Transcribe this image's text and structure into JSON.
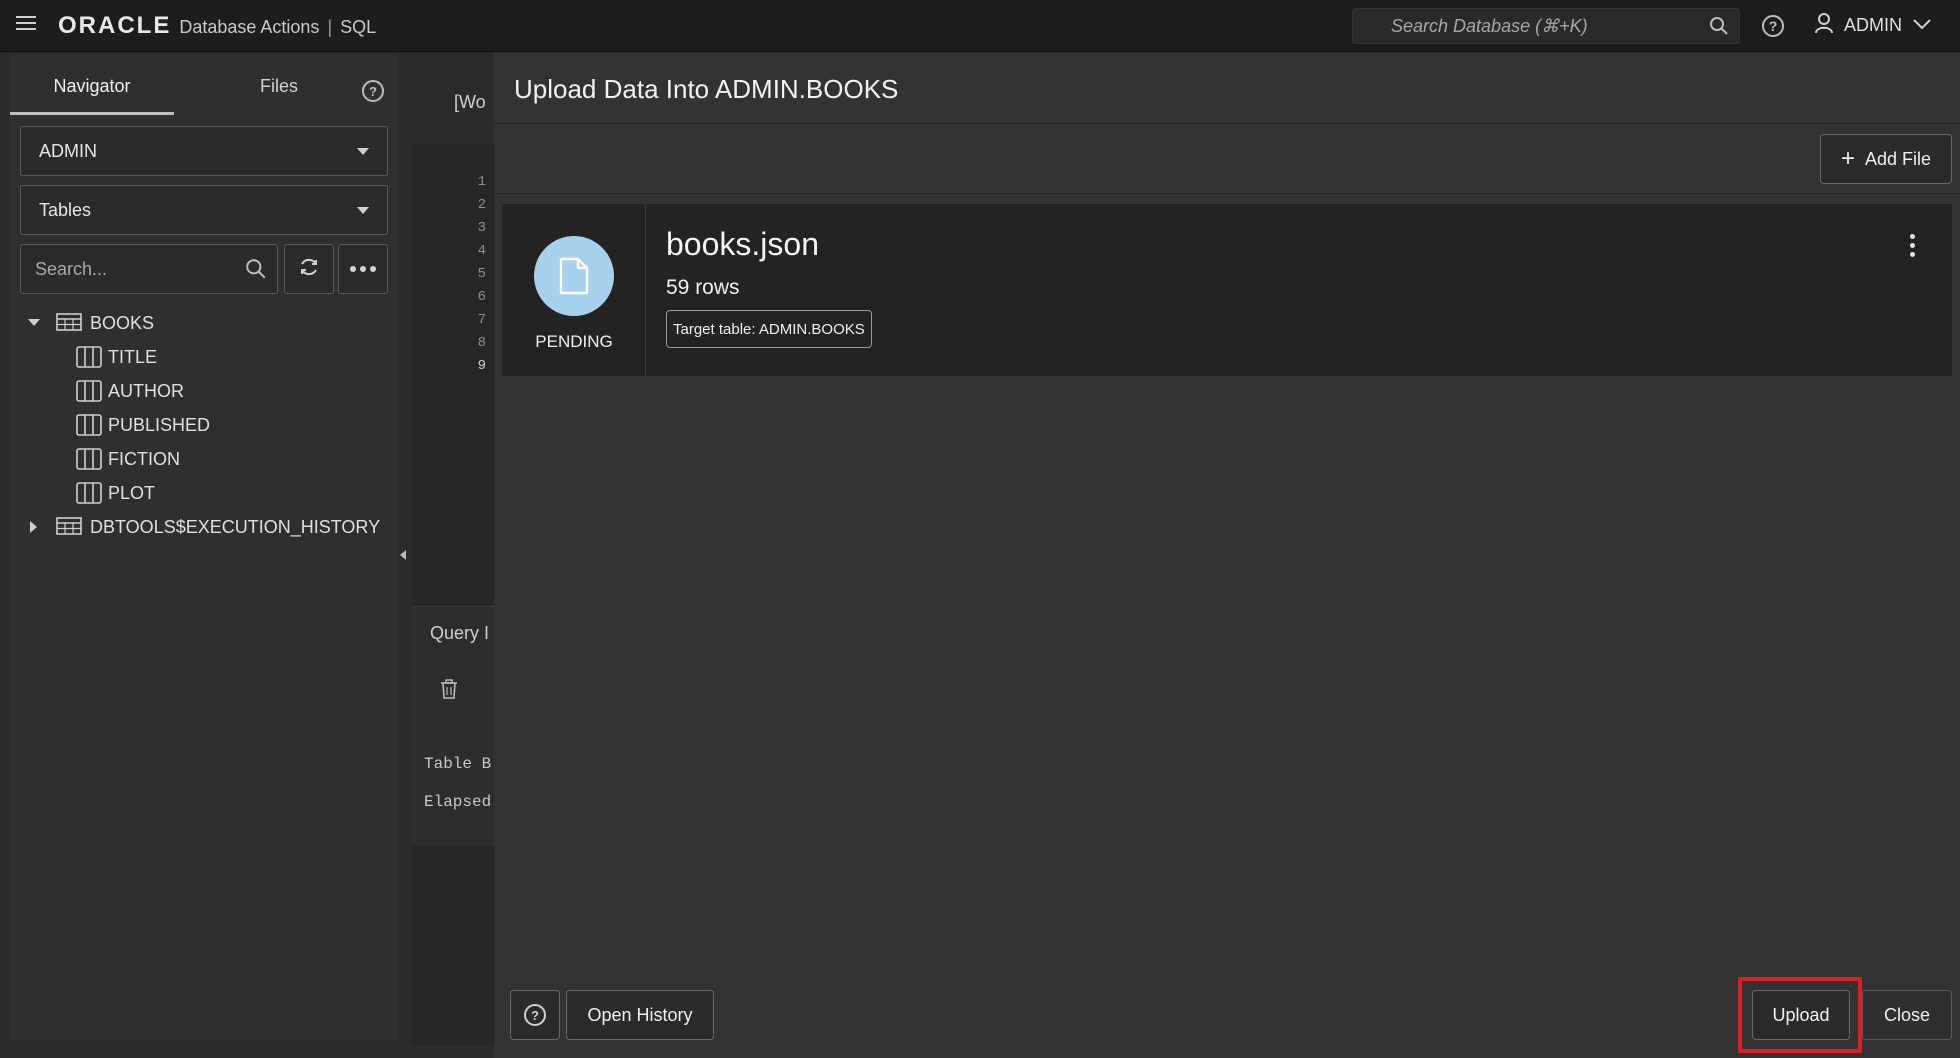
{
  "topbar": {
    "brand": "ORACLE",
    "app": "Database Actions",
    "separator": "|",
    "sub": "SQL",
    "search_placeholder": "Search Database (⌘+K)",
    "help_glyph": "?",
    "user": "ADMIN"
  },
  "navigator": {
    "tabs": [
      {
        "label": "Navigator",
        "active": true
      },
      {
        "label": "Files",
        "active": false
      }
    ],
    "help_glyph": "?",
    "schema_select": "ADMIN",
    "type_select": "Tables",
    "search_placeholder": "Search...",
    "tree": [
      {
        "label": "BOOKS",
        "type": "table",
        "expanded": true,
        "children": [
          {
            "label": "TITLE",
            "type": "column"
          },
          {
            "label": "AUTHOR",
            "type": "column"
          },
          {
            "label": "PUBLISHED",
            "type": "column"
          },
          {
            "label": "FICTION",
            "type": "column"
          },
          {
            "label": "PLOT",
            "type": "column"
          }
        ]
      },
      {
        "label": "DBTOOLS$EXECUTION_HISTORY",
        "type": "table",
        "expanded": false
      }
    ]
  },
  "editor": {
    "worksheet_tab": "[Wo",
    "line_numbers": [
      "1",
      "2",
      "3",
      "4",
      "5",
      "6",
      "7",
      "8",
      "9"
    ],
    "query_tab": "Query I",
    "output_lines": [
      "Table B",
      "Elapsed"
    ]
  },
  "modal": {
    "title": "Upload Data Into ADMIN.BOOKS",
    "add_file_label": "Add File",
    "file": {
      "name": "books.json",
      "rows": "59 rows",
      "target": "Target table: ADMIN.BOOKS",
      "status": "PENDING"
    },
    "help_glyph": "?",
    "open_history_label": "Open History",
    "upload_label": "Upload",
    "close_label": "Close"
  },
  "colors": {
    "topbar_bg": "#1d1d1d",
    "modal_bg": "#333333",
    "file_icon_circle": "#a8d1ee",
    "highlight": "#e02020"
  },
  "icons": [
    "hamburger-icon",
    "search-icon",
    "help-icon",
    "user-icon",
    "chevron-down-icon",
    "refresh-icon",
    "more-icon",
    "table-icon",
    "column-icon",
    "caret-down-icon",
    "caret-right-icon",
    "file-icon",
    "kebab-icon",
    "plus-icon",
    "trash-icon"
  ]
}
